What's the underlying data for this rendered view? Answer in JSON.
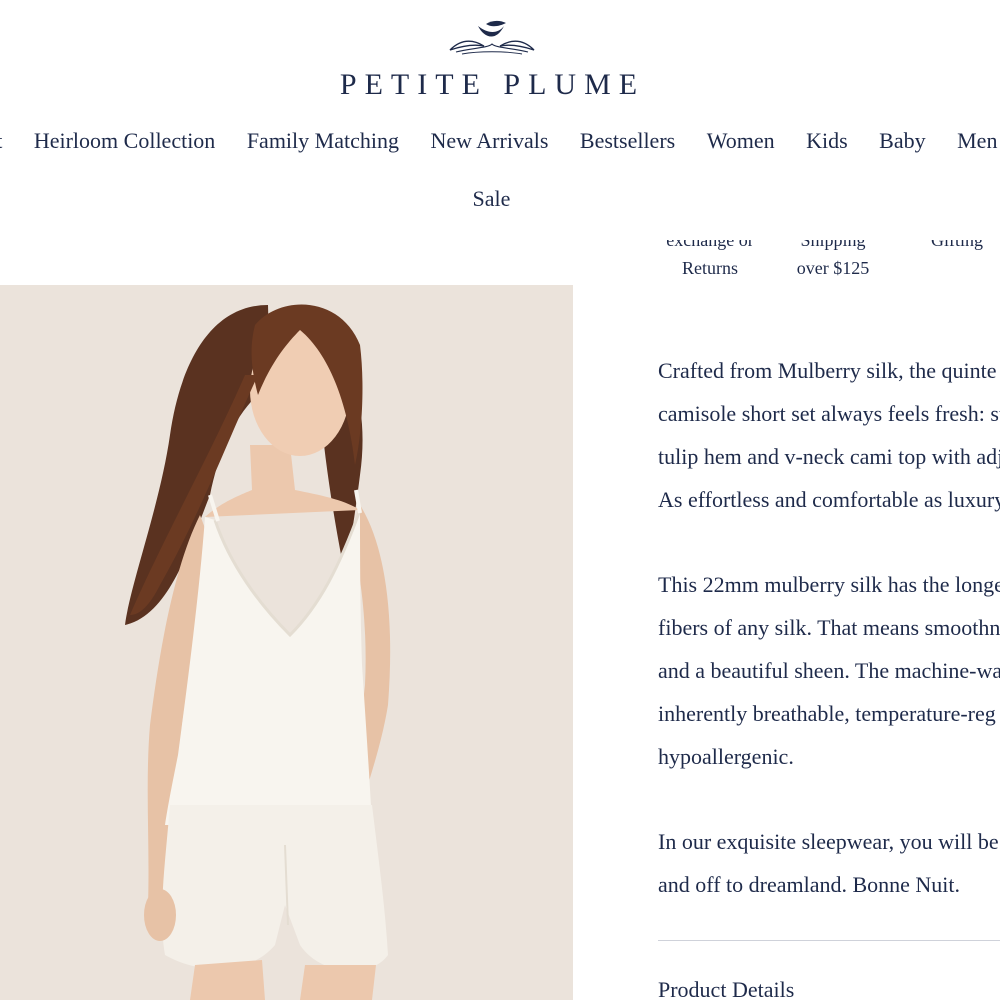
{
  "brand": {
    "name": "PETITE PLUME",
    "logo_icon": "feather-plume-icon"
  },
  "nav": {
    "items": [
      "lit",
      "Heirloom Collection",
      "Family Matching",
      "New Arrivals",
      "Bestsellers",
      "Women",
      "Kids",
      "Baby",
      "Men"
    ],
    "sale": "Sale"
  },
  "benefits": [
    {
      "line1": "exchange or",
      "line2": "Returns"
    },
    {
      "line1": "Shipping",
      "line2": "over $125"
    },
    {
      "line1": "Gifting",
      "line2": ""
    }
  ],
  "product": {
    "image_alt": "Model wearing ivory silk camisole short set",
    "description": [
      [
        "Crafted from Mulberry silk, the quinte",
        "camisole short set always feels fresh: su",
        "tulip hem and v-neck cami top with adj",
        "As effortless and comfortable as luxury"
      ],
      [
        "This 22mm mulberry silk has the longe",
        "fibers of any silk. That means smoothne",
        "and a beautiful sheen. The machine-wa",
        "inherently breathable, temperature-reg",
        "hypoallergenic."
      ],
      [
        "In our exquisite sleepwear, you will be t",
        "and off to dreamland. Bonne Nuit."
      ]
    ],
    "details_heading": "Product Details"
  },
  "colors": {
    "navy": "#1e2a4a",
    "image_background": "#ebe3db",
    "divider": "#cfd2da"
  }
}
